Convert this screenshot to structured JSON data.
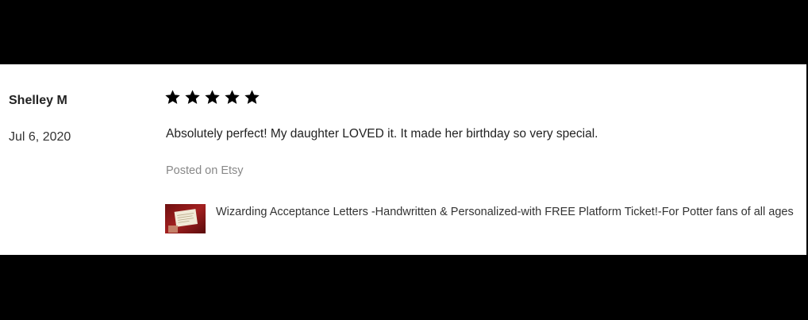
{
  "review": {
    "reviewer_name": "Shelley M",
    "date": "Jul 6, 2020",
    "rating": 5,
    "rating_max": 5,
    "text": "Absolutely perfect! My daughter LOVED it. It made her birthday so very special.",
    "source": "Posted on Etsy"
  },
  "product": {
    "title": "Wizarding Acceptance Letters -Handwritten & Personalized-with FREE Platform Ticket!-For Potter fans of all ages"
  },
  "colors": {
    "background": "#000000",
    "card": "#ffffff",
    "star": "#000000",
    "muted_text": "#888888",
    "thumbnail_red": "#8b1a1a"
  },
  "icons": {
    "star": "star-icon",
    "thumbnail": "product-thumbnail"
  }
}
